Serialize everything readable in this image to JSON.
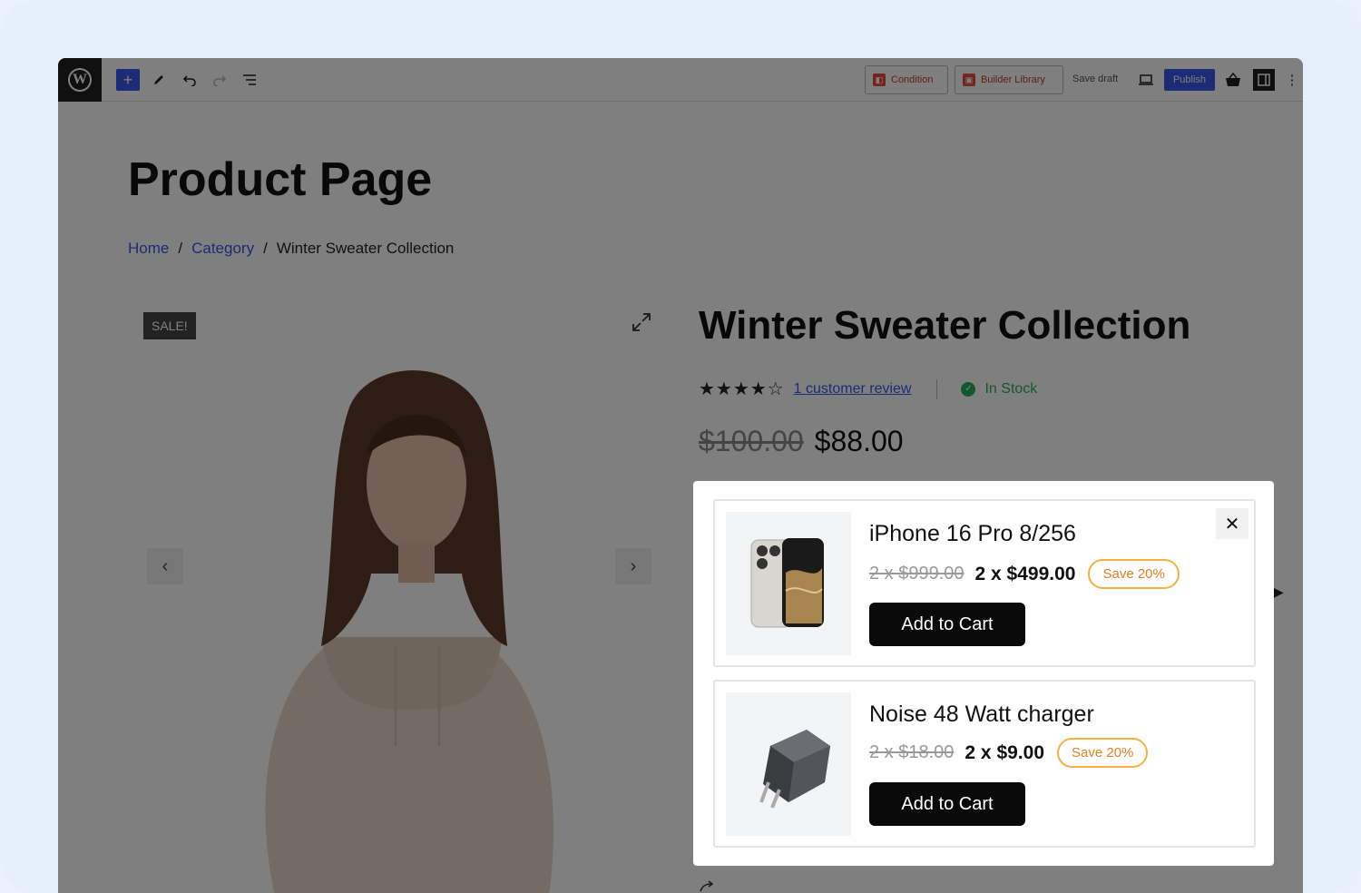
{
  "toolbar": {
    "add_icon": "plus",
    "condition_label": "Condition",
    "builder_library_label": "Builder Library",
    "save_draft_label": "Save draft",
    "publish_label": "Publish",
    "more_label": "⋮"
  },
  "page": {
    "title": "Product Page",
    "breadcrumb": {
      "home": "Home",
      "category": "Category",
      "current": "Winter Sweater Collection",
      "separator": "/"
    }
  },
  "product": {
    "sale_badge": "SALE!",
    "title": "Winter Sweater Collection",
    "rating": 4,
    "rating_max": 5,
    "stars_display": "★★★★☆",
    "review_link": "1 customer review",
    "stock": "In Stock",
    "old_price": "$100.00",
    "new_price": "$88.00",
    "prev_arrow": "‹",
    "next_arrow": "›"
  },
  "popup": {
    "close_label": "✕",
    "items": [
      {
        "name": "iPhone 16 Pro 8/256",
        "old_price": "2 x $999.00",
        "new_price": "2 x $499.00",
        "save_label": "Save 20%",
        "button_label": "Add to Cart"
      },
      {
        "name": "Noise 48 Watt charger",
        "old_price": "2 x $18.00",
        "new_price": "2 x $9.00",
        "save_label": "Save 20%",
        "button_label": "Add to Cart"
      }
    ]
  },
  "colors": {
    "accent": "#3858e9",
    "save_badge": "#f5b041",
    "in_stock": "#27ae60",
    "button": "#0a0a0a"
  }
}
